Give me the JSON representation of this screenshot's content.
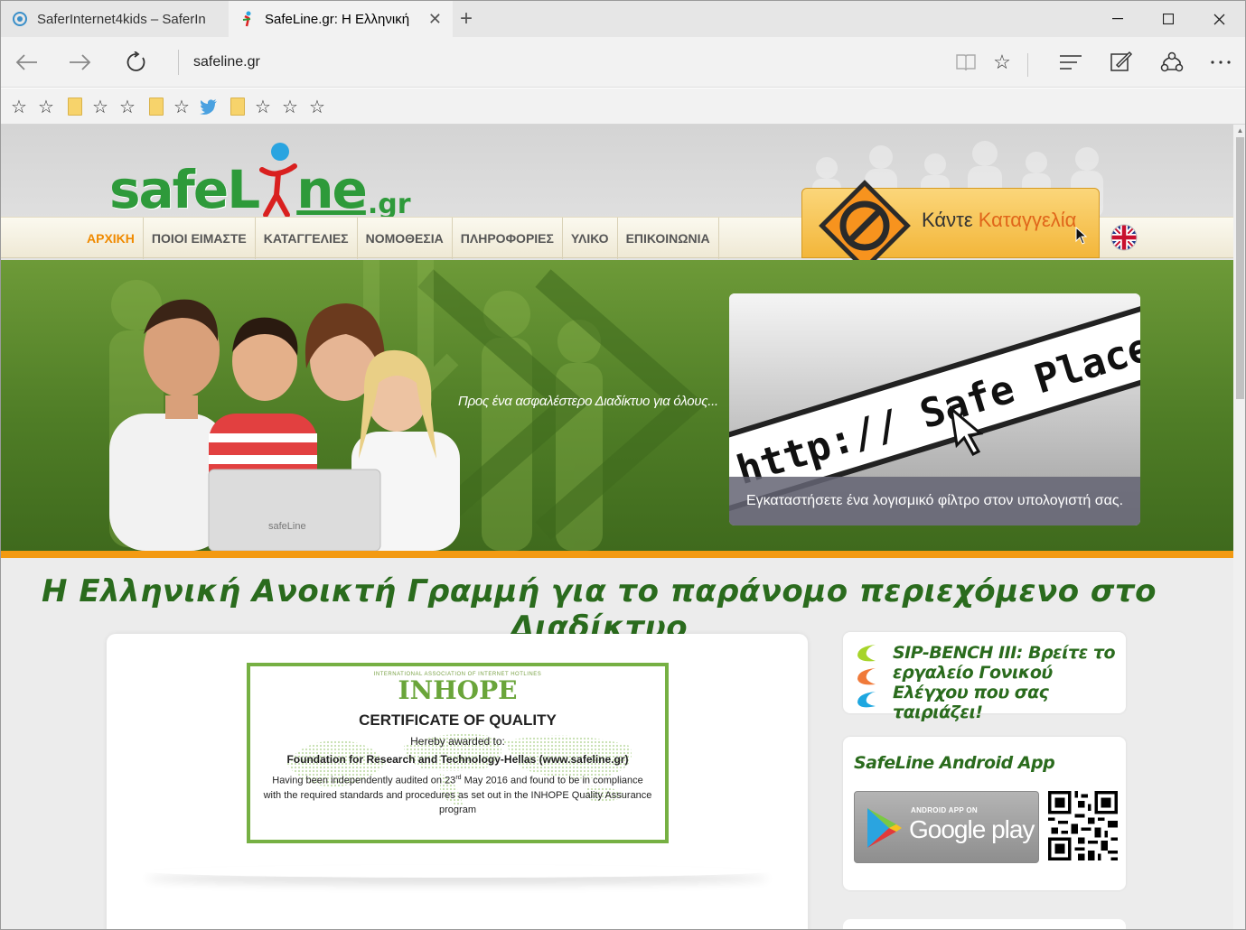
{
  "browser": {
    "tabs": [
      {
        "title": "SaferInternet4kids – SaferIn",
        "active": false
      },
      {
        "title": "SafeLine.gr: Η Ελληνική",
        "active": true
      }
    ],
    "new_tab_symbol": "+",
    "window_controls": {
      "minimize": "—",
      "maximize": "☐",
      "close": "✕"
    },
    "address": "safeline.gr",
    "nav_icons": [
      "back-arrow-icon",
      "forward-arrow-icon",
      "refresh-icon"
    ],
    "toolbar_icons": [
      "reading-view-icon",
      "favorite-star-icon",
      "hub-icon",
      "web-note-icon",
      "share-icon",
      "more-icon"
    ],
    "favorites": [
      "star",
      "star",
      "folder",
      "star",
      "star",
      "folder",
      "star",
      "twitter",
      "folder",
      "star",
      "star",
      "star"
    ]
  },
  "site": {
    "logo": {
      "part1": "safe",
      "part2": "L",
      "part3": "ne",
      "part4": ".gr"
    },
    "menu": [
      {
        "label": "ΑΡΧΙΚΗ",
        "active": true
      },
      {
        "label": "ΠΟΙΟΙ ΕΙΜΑΣΤΕ",
        "active": false
      },
      {
        "label": "ΚΑΤΑΓΓΕΛΙΕΣ",
        "active": false
      },
      {
        "label": "ΝΟΜΟΘΕΣΙΑ",
        "active": false
      },
      {
        "label": "ΠΛΗΡΟΦΟΡΙΕΣ",
        "active": false
      },
      {
        "label": "ΥΛΙΚΟ",
        "active": false
      },
      {
        "label": "ΕΠΙΚΟΙΝΩΝΙΑ",
        "active": false
      }
    ],
    "report_button": {
      "text1": "Κάντε ",
      "text2": "Καταγγελία"
    },
    "banner": {
      "tagline": "Προς ένα ασφαλέστερο Διαδίκτυο για όλους...",
      "laptop_logo": "safeLine",
      "safeplace_url": "http:// Safe Place...",
      "safeplace_caption": "Εγκαταστήσετε ένα λογισμικό φίλτρο στον υπολογιστή σας."
    },
    "headline": "Η Ελληνική Ανοικτή Γραμμή για το παράνομο περιεχόμενο στο Διαδίκτυο",
    "certificate": {
      "org": "INTERNATIONAL ASSOCIATION OF INTERNET HOTLINES",
      "brand": "INHOPE",
      "title": "CERTIFICATE OF QUALITY",
      "line1": "Hereby awarded to:",
      "line2": "Foundation for Research and Technology-Hellas (www.safeline.gr)",
      "line3a": "Having been independently audited on 23",
      "line3sup": "rd",
      "line3b": " May 2016 and found to be in compliance with the required standards and procedures as set out in the INHOPE Quality Assurance program"
    },
    "sidebar": {
      "sip_text": "SIP-BENCH III: Βρείτε το εργαλείο Γονικού Ελέγχου που σας ταιριάζει!",
      "android_title": "SafeLine Android App",
      "gplay_small": "ANDROID APP ON",
      "gplay_big": "Google play"
    },
    "colors": {
      "accent": "#f08a00",
      "green": "#2a6b1d",
      "banner_bar": "#f39a12"
    }
  }
}
